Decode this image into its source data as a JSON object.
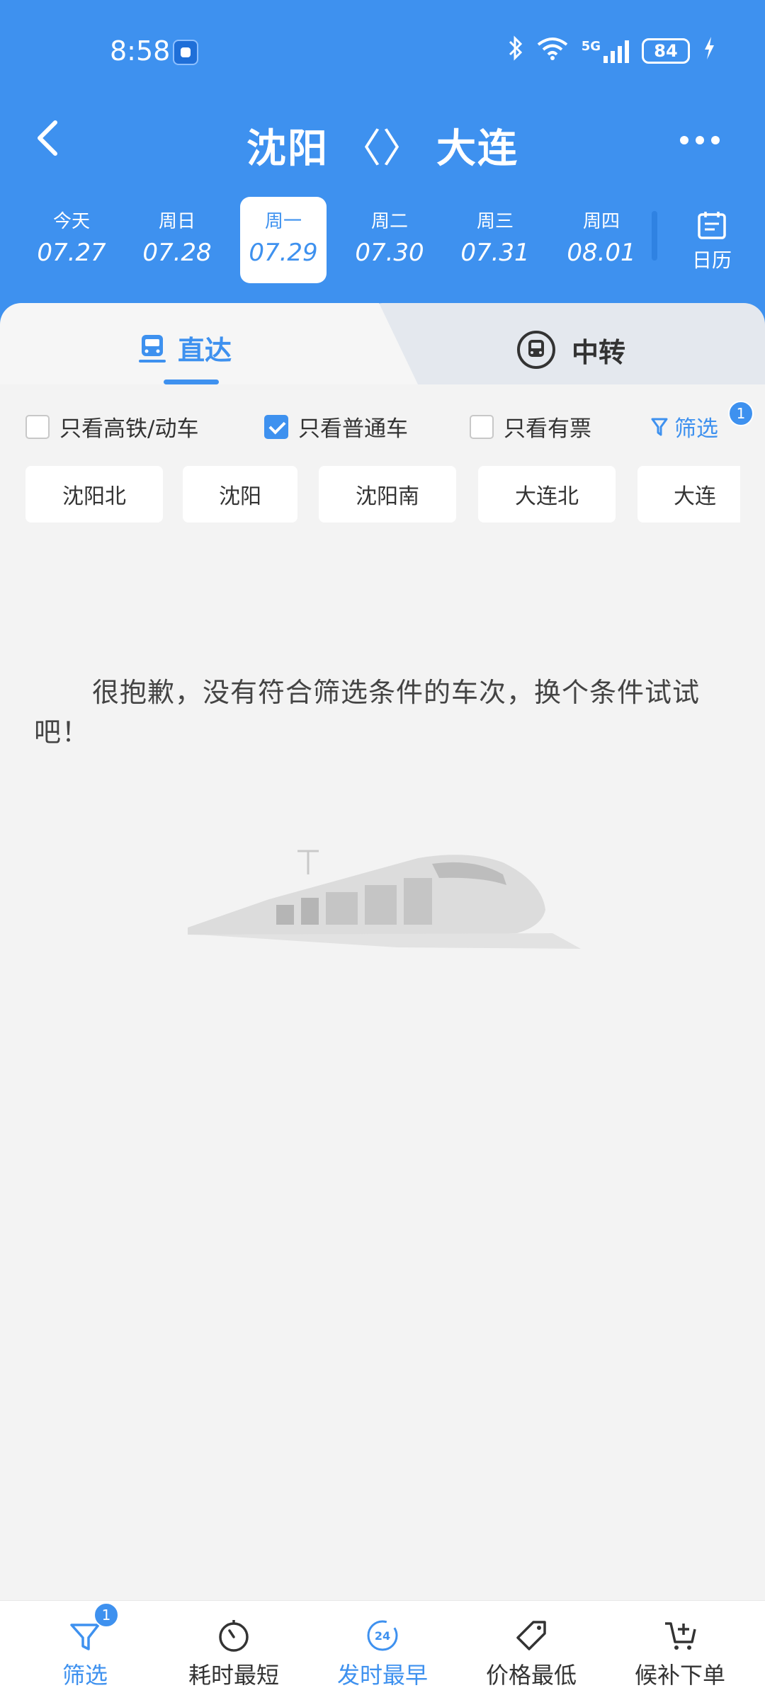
{
  "status_bar": {
    "time": "8:58",
    "network": "5G",
    "battery": "84"
  },
  "nav": {
    "from": "沈阳",
    "swap": "〈〉",
    "to": "大连"
  },
  "dates": [
    {
      "weekday": "今天",
      "date": "07.27"
    },
    {
      "weekday": "周日",
      "date": "07.28"
    },
    {
      "weekday": "周一",
      "date": "07.29",
      "selected": true
    },
    {
      "weekday": "周二",
      "date": "07.30"
    },
    {
      "weekday": "周三",
      "date": "07.31"
    },
    {
      "weekday": "周四",
      "date": "08.01"
    }
  ],
  "calendar_label": "日历",
  "tabs": {
    "direct": "直达",
    "transfer": "中转"
  },
  "filters": {
    "high_speed": {
      "label": "只看高铁/动车",
      "checked": false
    },
    "normal": {
      "label": "只看普通车",
      "checked": true
    },
    "available": {
      "label": "只看有票",
      "checked": false
    },
    "filter_label": "筛选",
    "filter_count": "1"
  },
  "stations": [
    "沈阳北",
    "沈阳",
    "沈阳南",
    "大连北",
    "大连"
  ],
  "empty_message": "很抱歉，没有符合筛选条件的车次，换个条件试试吧！",
  "bottom_bar": {
    "filter": "筛选",
    "filter_count": "1",
    "shortest": "耗时最短",
    "earliest": "发时最早",
    "earliest_icon_text": "24",
    "cheapest": "价格最低",
    "waitlist": "候补下单"
  },
  "colors": {
    "primary": "#3e91ef",
    "background": "#f3f3f3"
  }
}
